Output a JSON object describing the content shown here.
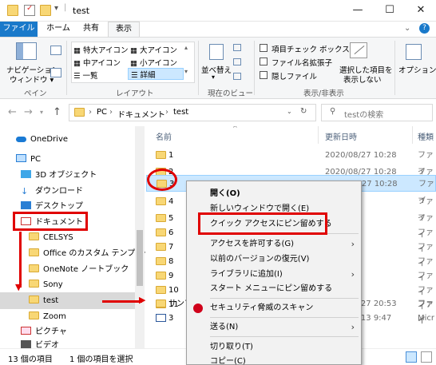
{
  "window": {
    "title": "test",
    "minimize": "—",
    "maximize": "☐",
    "close": "✕",
    "help": "?"
  },
  "tabs": [
    "ファイル",
    "ホーム",
    "共有",
    "表示"
  ],
  "ribbon": {
    "nav_pane": "ナビゲーション\nウィンドウ",
    "nav_pane_line1": "ナビゲーション",
    "nav_pane_line2": "ウィンドウ ▾",
    "group_pane": "ペイン",
    "layout": [
      "特大アイコン",
      "大アイコン",
      "中アイコン",
      "小アイコン",
      "一覧",
      "詳細"
    ],
    "group_layout": "レイアウト",
    "sort_line1": "並べ替え",
    "group_current_view": "現在のビュー",
    "checkboxes": [
      "項目チェック ボックス",
      "ファイル名拡張子",
      "隠しファイル"
    ],
    "hide_selected_line1": "選択した項目を",
    "hide_selected_line2": "表示しない",
    "options": "オプション",
    "group_show_hide": "表示/非表示"
  },
  "address": {
    "path": [
      "PC",
      "ドキュメント",
      "test"
    ],
    "search_placeholder": "testの検索"
  },
  "nav": {
    "onedrive": "OneDrive",
    "pc": "PC",
    "objects3d": "3D オブジェクト",
    "downloads": "ダウンロード",
    "desktop": "デスクトップ",
    "documents": "ドキュメント",
    "celsys": "CELSYS",
    "office_templates": "Office のカスタム テンプレー",
    "onenote": "OneNote ノートブック",
    "sony": "Sony",
    "test": "test",
    "zoom": "Zoom",
    "pictures": "ピクチャ",
    "videos": "ビデオ"
  },
  "columns": {
    "name": "名前",
    "date": "更新日時",
    "type": "種類"
  },
  "files": [
    {
      "name": "1",
      "date": "2020/08/27 10:28",
      "type": "ファイ"
    },
    {
      "name": "2",
      "date": "2020/08/27 10:28",
      "type": "ファイ"
    },
    {
      "name": "3",
      "date": "2020/08/27 10:28",
      "type": "ファイ"
    },
    {
      "name": "4",
      "date": "",
      "type": "ファイ"
    },
    {
      "name": "5",
      "date": "",
      "type": "ファイ"
    },
    {
      "name": "6",
      "date": "",
      "type": "ファイ"
    },
    {
      "name": "7",
      "date": "",
      "type": "ファイ"
    },
    {
      "name": "8",
      "date": "",
      "type": "ファイ"
    },
    {
      "name": "9",
      "date": "",
      "type": "ファイ"
    },
    {
      "name": "10",
      "date": "",
      "type": "ファイ"
    },
    {
      "name": "11",
      "date": "",
      "type": "ファイ"
    },
    {
      "name": "サンプ",
      "date": "2020/08/27 20:53",
      "type": "ファイ"
    },
    {
      "name": "3",
      "date": "2020/08/13 9:47",
      "type": "Micr"
    }
  ],
  "context_menu": {
    "open": "開く(O)",
    "open_new_window": "新しいウィンドウで開く(E)",
    "pin_quick_access": "クイック アクセスにピン留めする",
    "give_access": "アクセスを許可する(G)",
    "restore_previous": "以前のバージョンの復元(V)",
    "add_to_library": "ライブラリに追加(I)",
    "pin_start": "スタート メニューにピン留めする",
    "security_scan": "セキュリティ脅威のスキャン",
    "send_to": "送る(N)",
    "cut": "切り取り(T)",
    "copy": "コピー(C)"
  },
  "status": {
    "count": "13 個の項目",
    "selected": "1 個の項目を選択"
  },
  "colors": {
    "accent": "#1979ca",
    "annotation": "#e00000",
    "folder": "#f8d775",
    "selection": "#cce8ff"
  }
}
